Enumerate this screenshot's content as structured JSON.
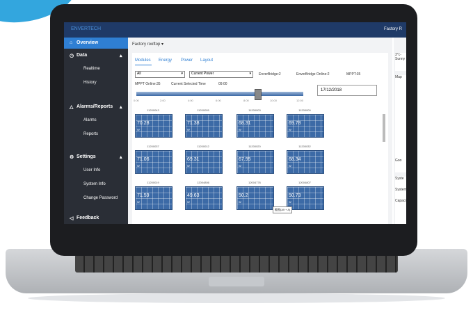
{
  "app": {
    "logo_text": "ENVERTECH",
    "factory_label": "Factory R"
  },
  "sidebar": {
    "overview": "Overview",
    "data": "Data",
    "realtime": "Realtime",
    "history": "History",
    "alarms_reports": "Alarms/Reports",
    "alarms": "Alarms",
    "reports": "Reports",
    "settings": "Settings",
    "user_info": "User Info",
    "system_info": "System Info",
    "change_password": "Change Password",
    "feedback": "Feedback"
  },
  "breadcrumb": "Factory rooftop",
  "tabs": [
    "Modules",
    "Energy",
    "Power",
    "Layout"
  ],
  "filters": {
    "group_select": "All",
    "metric_select": "Current Power",
    "enverbridge": "EnverBridge:2",
    "enverbridge_online": "EnverBridge Online:2",
    "mppt": "MPPT:35",
    "mppt_online": "MPPT Online:35",
    "current_selected_time_label": "Current Selected Time",
    "current_selected_time": "09:00",
    "date": "17/12/2018"
  },
  "time_ticks": [
    "0:00",
    "2:00",
    "4:00",
    "6:00",
    "8:00",
    "10:00",
    "12:00"
  ],
  "modules": [
    {
      "id": "11200043",
      "value": "70.28",
      "unit": "W"
    },
    {
      "id": "11200005",
      "value": "71.38",
      "unit": "W"
    },
    {
      "id": "11200003",
      "value": "68.31",
      "unit": "W"
    },
    {
      "id": "11200000",
      "value": "69.78",
      "unit": "W"
    },
    {
      "id": "11200037",
      "value": "71.06",
      "unit": "W"
    },
    {
      "id": "11200012",
      "value": "69.31",
      "unit": "W"
    },
    {
      "id": "11200020",
      "value": "67.95",
      "unit": "W"
    },
    {
      "id": "11200032",
      "value": "68.34",
      "unit": "W"
    },
    {
      "id": "11200019",
      "value": "71.59",
      "unit": "W"
    },
    {
      "id": "12004806",
      "value": "49.63",
      "unit": "W"
    },
    {
      "id": "12004776",
      "value": "50.2",
      "unit": "W"
    },
    {
      "id": "12004807",
      "value": "50.73",
      "unit": "W"
    }
  ],
  "tooltip": "截图(Alt + A)",
  "right_panel": {
    "weather_temp": "3°c-",
    "weather_desc": "Sunny",
    "map_title": "Map",
    "google": "Goo",
    "system_title": "Syste",
    "system_row": "System",
    "capacity_row": "Capaci"
  },
  "colors": {
    "topbar": "#1f3a67",
    "sidebar": "#2a2e36",
    "accent": "#2f7fd3",
    "module": "#3c6aa6"
  }
}
